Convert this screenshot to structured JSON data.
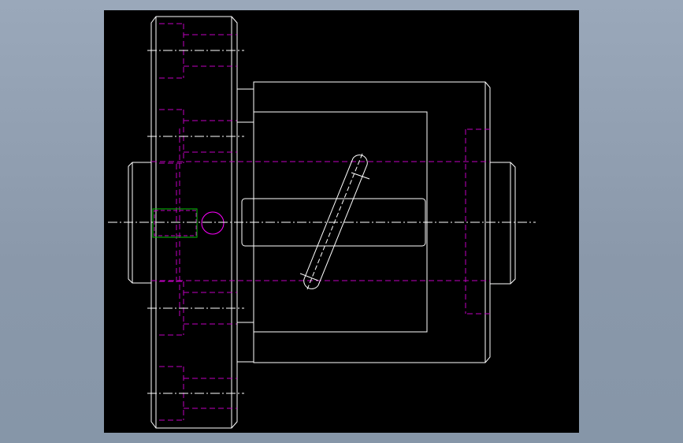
{
  "viewport": {
    "name": "cad-drawing-viewport",
    "background": "#000000"
  },
  "colors": {
    "outline": "#ffffff",
    "hidden_line": "#c000c0",
    "center_line": "#ffffff",
    "highlight_pin": "#00c000",
    "highlight_circle": "#ff00ff",
    "page_gradient_top": "#9aa8ba",
    "page_gradient_bottom": "#8696a8"
  },
  "drawing": {
    "view": "front-elevation",
    "components": [
      "left-flange-disc",
      "main-cylinder-body",
      "inner-bore-rectangle",
      "horizontal-slot",
      "diagonal-cam-slot",
      "left-shaft-stub",
      "right-shaft-stub",
      "pin-and-ball"
    ],
    "texts": []
  }
}
